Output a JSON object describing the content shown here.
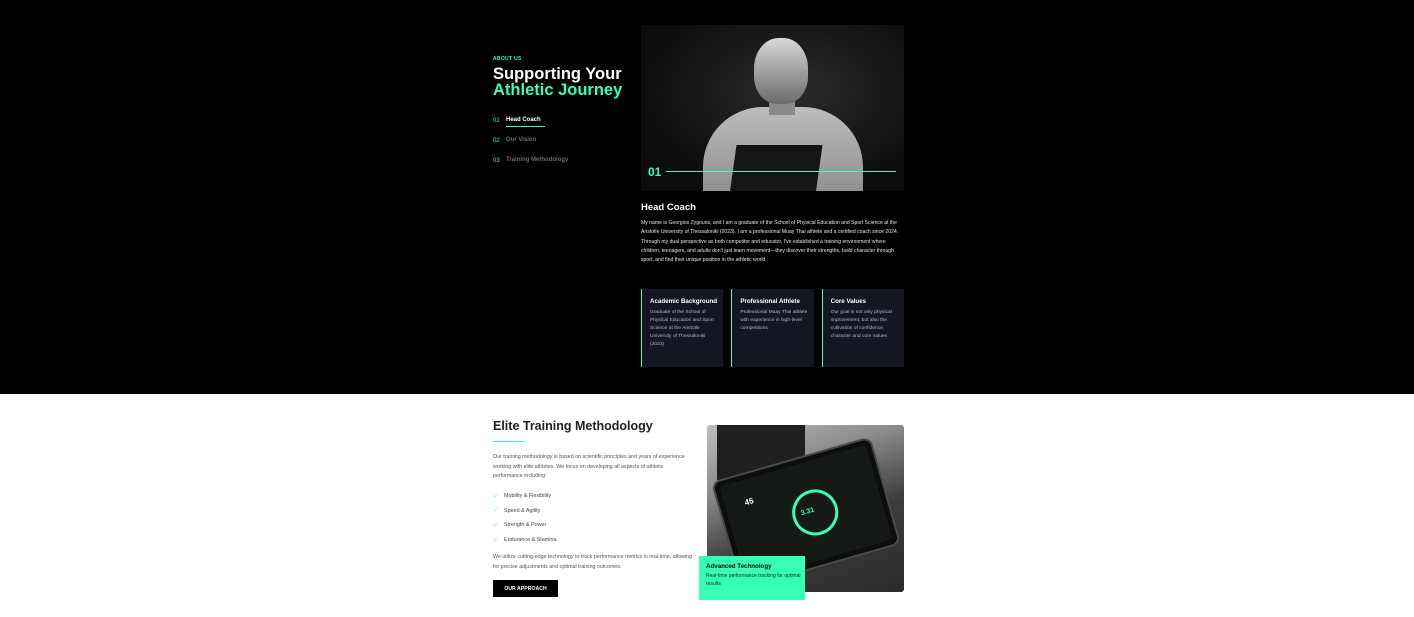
{
  "about": {
    "eyebrow": "ABOUT US",
    "title_line1": "Supporting Your",
    "title_line2": "Athletic Journey"
  },
  "nav": {
    "items": [
      {
        "num": "01",
        "label": "Head Coach",
        "active": true
      },
      {
        "num": "02",
        "label": "Our Vision",
        "active": false
      },
      {
        "num": "03",
        "label": "Training Methodology",
        "active": false
      }
    ]
  },
  "photo": {
    "number": "01"
  },
  "coach": {
    "title": "Head Coach",
    "bio": "My name is Georgios Zygouris, and I am a graduate of the School of Physical Education and Sport Science at the Aristotle University of Thessaloniki (2023). I am a professional Muay Thai athlete and a certified coach since 2024. Through my dual perspective as both competitor and educator, I've established a training environment where children, teenagers, and adults don't just learn movement—they discover their strengths, build character through sport, and find their unique position in the athletic world."
  },
  "cards": [
    {
      "title": "Academic Background",
      "desc": "Graduate of the School of Physical Education and Sport Science at the Aristotle University of Thessaloniki (2023)"
    },
    {
      "title": "Professional Athlete",
      "desc": "Professional Muay Thai athlete with experience in high-level competitions"
    },
    {
      "title": "Core Values",
      "desc": "Our goal is not only physical improvement, but also the cultivation of confidence, character and core values"
    }
  ],
  "methodology": {
    "title": "Elite Training Methodology",
    "intro": "Our training methodology is based on scientific principles and years of experience working with elite athletes. We focus on developing all aspects of athletic performance including:",
    "items": [
      "Mobility & Flexibility",
      "Speed & Agility",
      "Strength & Power",
      "Endurance & Stamina"
    ],
    "check_icon": "check-icon",
    "outro": "We utilize cutting-edge technology to track performance metrics in real-time, allowing for precise adjustments and optimal training outcomes.",
    "button": "OUR APPROACH"
  },
  "tablet": {
    "metric": "45",
    "ring_value": "3.31"
  },
  "badge": {
    "title": "Advanced Technology",
    "desc": "Real-time performance tracking for optimal results"
  },
  "colors": {
    "accent": "#36ffb6",
    "dark_bg": "#000000",
    "card_bg": "#141722"
  }
}
